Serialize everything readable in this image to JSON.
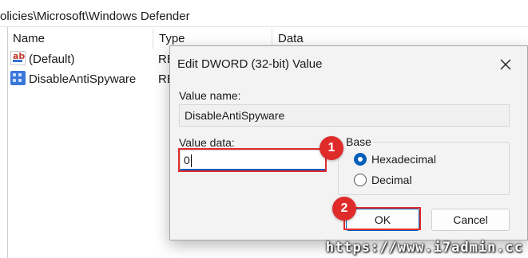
{
  "address_bar": {
    "path": "olicies\\Microsoft\\Windows Defender"
  },
  "list": {
    "columns": [
      "Name",
      "Type",
      "Data"
    ],
    "rows": [
      {
        "name": "(Default)",
        "type": "RE",
        "icon": "string-value-icon"
      },
      {
        "name": "DisableAntiSpyware",
        "type": "RE",
        "icon": "binary-value-icon"
      }
    ]
  },
  "dialog": {
    "title": "Edit DWORD (32-bit) Value",
    "value_name_label": "Value name:",
    "value_name": "DisableAntiSpyware",
    "value_data_label": "Value data:",
    "value_data": "0",
    "base_label": "Base",
    "base_options": [
      {
        "label": "Hexadecimal",
        "selected": true
      },
      {
        "label": "Decimal",
        "selected": false
      }
    ],
    "ok_label": "OK",
    "cancel_label": "Cancel"
  },
  "annotations": {
    "step1": "1",
    "step2": "2",
    "color": "#e02b2b"
  },
  "watermark": "https://www.i7admin.cc",
  "colors": {
    "accent": "#005fb8",
    "highlight": "#e02b2b"
  }
}
